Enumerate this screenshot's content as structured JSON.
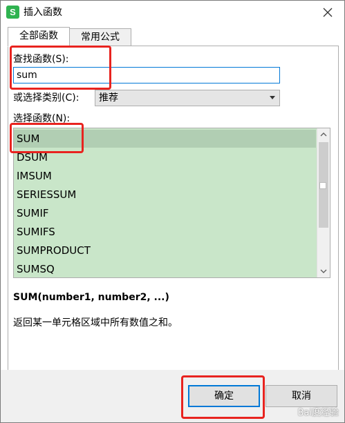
{
  "window": {
    "title": "插入函数",
    "app_icon_letter": "S"
  },
  "tabs": [
    {
      "label": "全部函数",
      "active": true
    },
    {
      "label": "常用公式",
      "active": false
    }
  ],
  "search": {
    "label": "查找函数(S):",
    "value": "sum",
    "placeholder": ""
  },
  "category": {
    "label": "或选择类别(C):",
    "selected": "推荐"
  },
  "function_list": {
    "label": "选择函数(N):",
    "items": [
      "SUM",
      "DSUM",
      "IMSUM",
      "SERIESSUM",
      "SUMIF",
      "SUMIFS",
      "SUMPRODUCT",
      "SUMSQ"
    ],
    "selected_index": 0
  },
  "details": {
    "signature": "SUM(number1, number2, ...)",
    "description": "返回某一单元格区域中所有数值之和。"
  },
  "buttons": {
    "ok": "确定",
    "cancel": "取消"
  },
  "watermark": "Bai度经验",
  "colors": {
    "list_background": "#c9e6c9",
    "list_selected": "#b1ceb3",
    "annotation_red": "#e8231f",
    "focus_blue": "#0078d7",
    "app_icon_green": "#2fb350"
  }
}
